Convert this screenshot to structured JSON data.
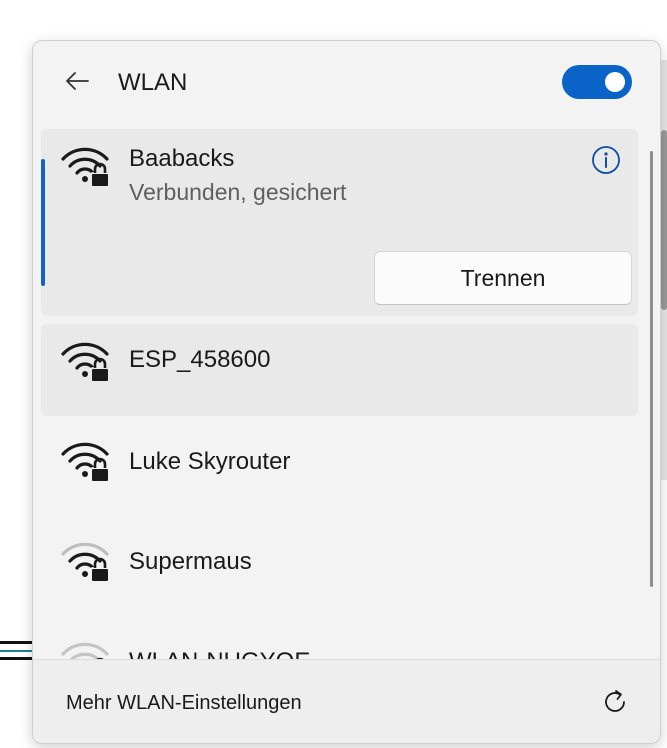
{
  "header": {
    "title": "WLAN",
    "back_icon": "arrow-left-icon",
    "wifi_enabled": true
  },
  "networks": [
    {
      "ssid": "Baabacks",
      "status": "Verbunden, gesichert",
      "secured": true,
      "connected": true,
      "action_label": "Trennen",
      "icon": "wifi-lock-icon"
    },
    {
      "ssid": "ESP_458600",
      "secured": true,
      "icon": "wifi-lock-icon"
    },
    {
      "ssid": "Luke Skyrouter",
      "secured": true,
      "icon": "wifi-lock-icon"
    },
    {
      "ssid": "Supermaus",
      "secured": true,
      "icon": "wifi-lock-icon"
    },
    {
      "ssid": "WLAN-NUGYOE",
      "secured": true,
      "icon": "wifi-lock-icon"
    }
  ],
  "footer": {
    "more_settings_label": "Mehr WLAN-Einstellungen",
    "refresh_icon": "refresh-icon"
  },
  "colors": {
    "accent": "#0a64c8",
    "panel_bg": "#f3f3f3",
    "selected_bg": "#e9e9e9"
  }
}
